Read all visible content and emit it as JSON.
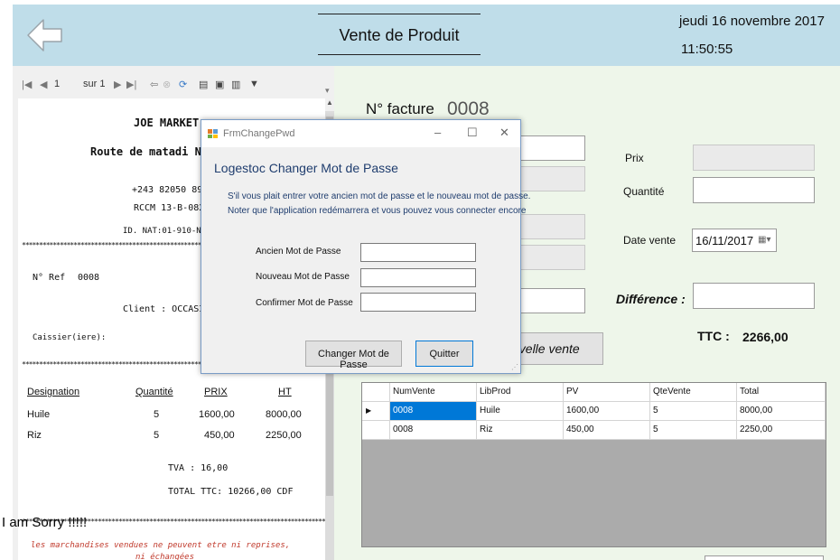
{
  "header": {
    "title": "Vente de Produit",
    "date": "jeudi 16 novembre 2017",
    "time": "11:50:55",
    "back_icon": "back-arrow-icon",
    "color": "#bfdde9"
  },
  "report_toolbar": {
    "page_number": "1",
    "page_of": "sur 1"
  },
  "receipt": {
    "store_name": "JOE MARKET",
    "address": "Route de matadi N°",
    "phone": "+243 82050 897",
    "rccm": "RCCM 13-B-082",
    "id_nat": "ID. NAT:01-910-N66",
    "ref_label": "N° Ref",
    "ref_value": "0008",
    "client": "Client : OCCASIC",
    "cashier": "Caissier(iere):",
    "columns": [
      "Designation",
      "Quantité",
      "PRIX",
      "HT"
    ],
    "rows": [
      {
        "designation": "Huile",
        "quantite": "5",
        "prix": "1600,00",
        "ht": "8000,00"
      },
      {
        "designation": "Riz",
        "quantite": "5",
        "prix": "450,00",
        "ht": "2250,00"
      }
    ],
    "tva": "TVA     : 16,00",
    "total_ttc": "TOTAL TTC: 10266,00 CDF",
    "footer_line1": "les marchandises vendues ne peuvent etre ni reprises,",
    "footer_line2": "ni échangées"
  },
  "overlay_text": "I am Sorry !!!!!",
  "form": {
    "invoice_label": "N° facture",
    "invoice_number": "0008",
    "prix_label": "Prix",
    "quantite_label": "Quantité",
    "date_vente_label": "Date vente",
    "date_vente_value": "16/11/2017",
    "difference_label": "Différence :",
    "ttc_label": "TTC :",
    "ttc_value": "2266,00",
    "new_sale_button": "uvelle vente"
  },
  "grid": {
    "columns": [
      "NumVente",
      "LibProd",
      "PV",
      "QteVente",
      "Total"
    ],
    "rows": [
      {
        "num": "0008",
        "lib": "Huile",
        "pv": "1600,00",
        "qte": "5",
        "total": "8000,00"
      },
      {
        "num": "0008",
        "lib": "Riz",
        "pv": "450,00",
        "qte": "5",
        "total": "2250,00"
      }
    ],
    "current_row_marker": "▶"
  },
  "dialog": {
    "window_title": "FrmChangePwd",
    "heading": "Logestoc Changer Mot de Passe",
    "info_line1": "S'il vous plait entrer votre ancien mot de passe et le nouveau mot de passe.",
    "info_line2": "Noter que l'application redémarrera et vous pouvez vous connecter encore",
    "old_password_label": "Ancien Mot de Passe",
    "new_password_label": "Nouveau Mot de Passe",
    "confirm_password_label": "Confirmer Mot de Passe",
    "change_button": "Changer Mot de Passe",
    "quit_button": "Quitter"
  },
  "colors": {
    "form_background": "#eef6ea",
    "selection": "#0078d7"
  }
}
